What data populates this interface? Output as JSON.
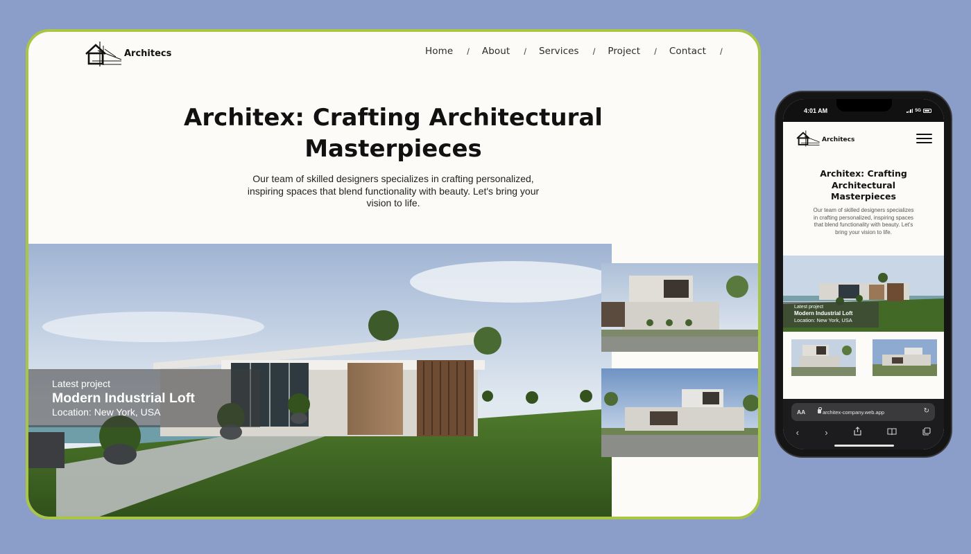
{
  "desktop": {
    "logo_text": "Architecs",
    "nav": [
      "Home",
      "About",
      "Services",
      "Project",
      "Contact"
    ],
    "nav_separator": "/",
    "hero_title_lines": [
      "Architex: Crafting Architectural",
      "Masterpieces"
    ],
    "hero_subtitle_lines": [
      "Our team of skilled designers specializes in crafting personalized,",
      "inspiring spaces that blend functionality with beauty. Let's bring your",
      "vision to life."
    ],
    "project": {
      "label": "Latest project",
      "name": "Modern Industrial Loft",
      "location": "Location: New York, USA"
    }
  },
  "mobile": {
    "status": {
      "time": "4:01 AM",
      "network": "5G"
    },
    "logo_text": "Architecs",
    "hero_title_lines": [
      "Architex: Crafting",
      "Architectural",
      "Masterpieces"
    ],
    "hero_subtitle_lines": [
      "Our team of skilled designers specializes",
      "in crafting personalized, inspiring spaces",
      "that blend functionality with beauty. Let's",
      "bring your vision to life."
    ],
    "project": {
      "label": "Latest project",
      "name": "Modern Industrial Loft",
      "location": "Location: New York, USA"
    },
    "browser": {
      "aa": "AA",
      "url": "architex-company.web.app",
      "toolbar_icons": [
        "back-icon",
        "forward-icon",
        "share-icon",
        "bookmarks-icon",
        "tabs-icon"
      ]
    }
  },
  "colors": {
    "background": "#8b9ec9",
    "frame_border": "#a9c545",
    "page_bg": "#fdfbf7",
    "text_dark": "#111111"
  }
}
